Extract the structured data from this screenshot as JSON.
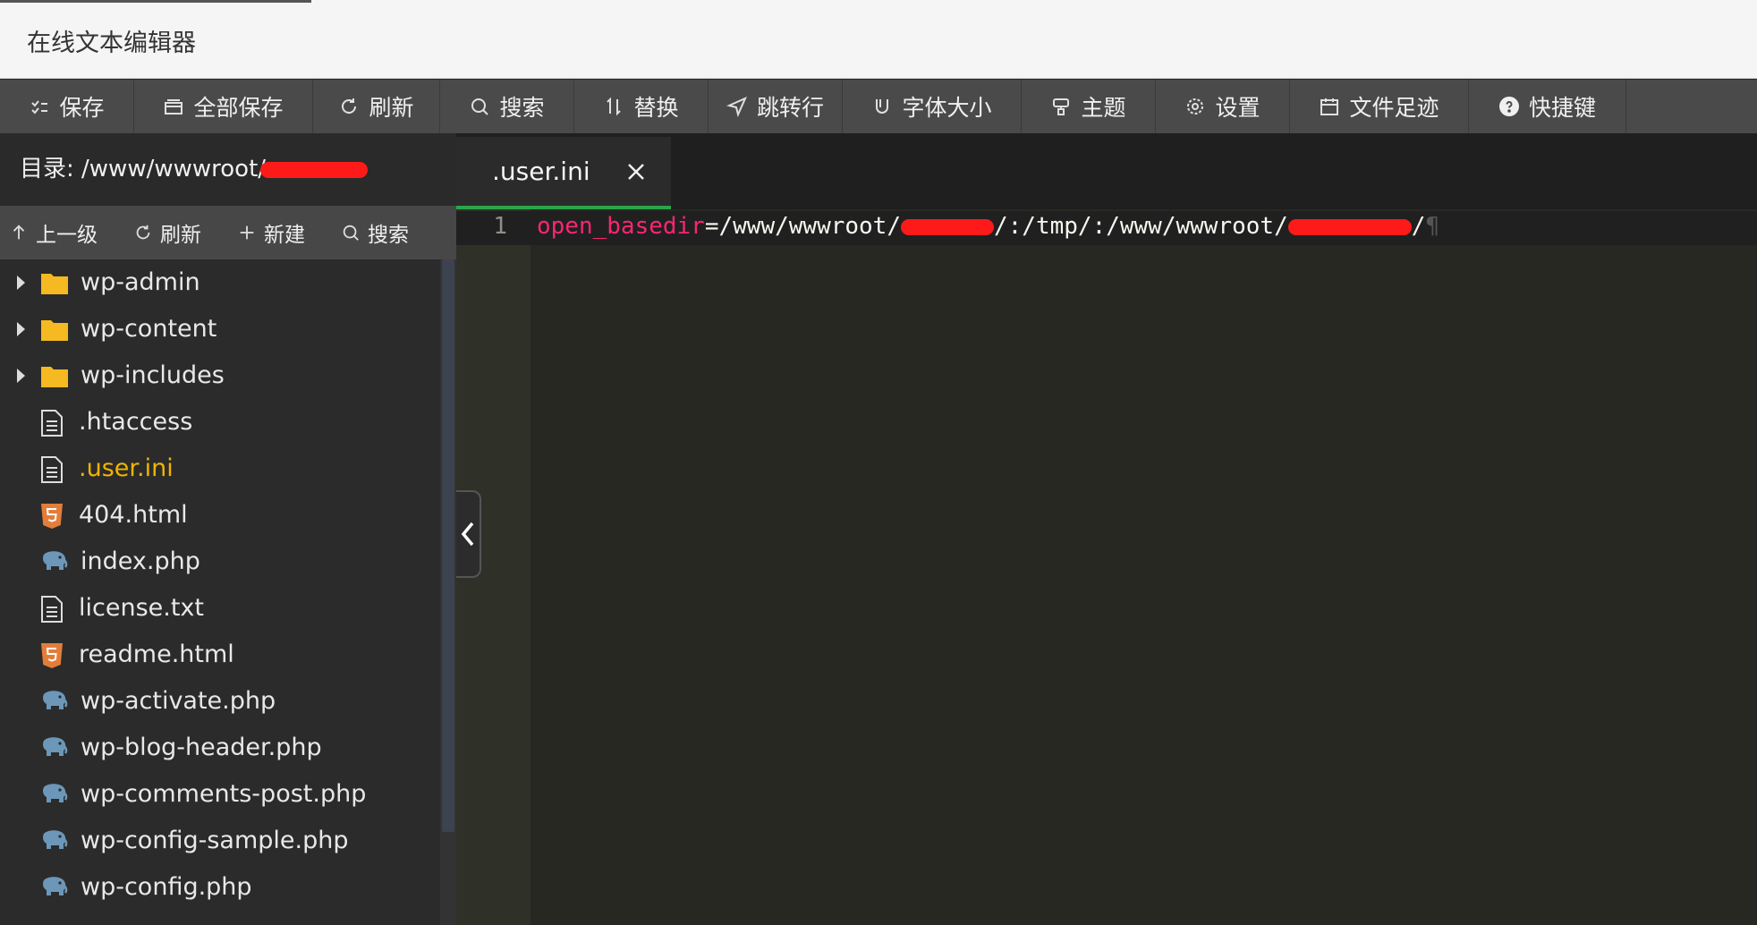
{
  "window": {
    "title": "在线文本编辑器"
  },
  "toolbar": {
    "buttons": [
      {
        "label": "保存",
        "icon": "save-icon"
      },
      {
        "label": "全部保存",
        "icon": "save-all-icon"
      },
      {
        "label": "刷新",
        "icon": "refresh-icon"
      },
      {
        "label": "搜索",
        "icon": "search-icon"
      },
      {
        "label": "替换",
        "icon": "replace-icon"
      },
      {
        "label": "跳转行",
        "icon": "goto-line-icon"
      },
      {
        "label": "字体大小",
        "icon": "font-size-icon"
      },
      {
        "label": "主题",
        "icon": "theme-icon"
      },
      {
        "label": "设置",
        "icon": "gear-icon"
      },
      {
        "label": "文件足迹",
        "icon": "calendar-icon"
      },
      {
        "label": "快捷键",
        "icon": "help-icon"
      }
    ]
  },
  "sidebar": {
    "dir_label": "目录:",
    "dir_path": "/www/wwwroot/",
    "actions": [
      {
        "label": "上一级",
        "icon": "arrow-up-icon"
      },
      {
        "label": "刷新",
        "icon": "refresh-icon"
      },
      {
        "label": "新建",
        "icon": "plus-icon"
      },
      {
        "label": "搜索",
        "icon": "search-icon"
      }
    ],
    "tree": [
      {
        "name": "wp-admin",
        "type": "folder"
      },
      {
        "name": "wp-content",
        "type": "folder"
      },
      {
        "name": "wp-includes",
        "type": "folder"
      },
      {
        "name": ".htaccess",
        "type": "text"
      },
      {
        "name": ".user.ini",
        "type": "text",
        "active": true
      },
      {
        "name": "404.html",
        "type": "html"
      },
      {
        "name": "index.php",
        "type": "php"
      },
      {
        "name": "license.txt",
        "type": "text"
      },
      {
        "name": "readme.html",
        "type": "html"
      },
      {
        "name": "wp-activate.php",
        "type": "php"
      },
      {
        "name": "wp-blog-header.php",
        "type": "php"
      },
      {
        "name": "wp-comments-post.php",
        "type": "php"
      },
      {
        "name": "wp-config-sample.php",
        "type": "php"
      },
      {
        "name": "wp-config.php",
        "type": "php"
      }
    ]
  },
  "editor": {
    "tab": {
      "label": ".user.ini"
    },
    "lines": [
      {
        "number": "1",
        "key": "open_basedir",
        "segments": [
          "=/www/wwwroot/",
          "/:/tmp/:/www/wwwroot/",
          "/"
        ],
        "eol_mark": "¶"
      }
    ]
  },
  "colors": {
    "titlebar_bg": "#f5f5f5",
    "toolbar_bg": "#4a4a4a",
    "editor_bg": "#272822",
    "keyword": "#f92672",
    "active_file": "#f0b400",
    "tab_underline": "#2aa54a",
    "redaction": "#ff1a1a"
  }
}
